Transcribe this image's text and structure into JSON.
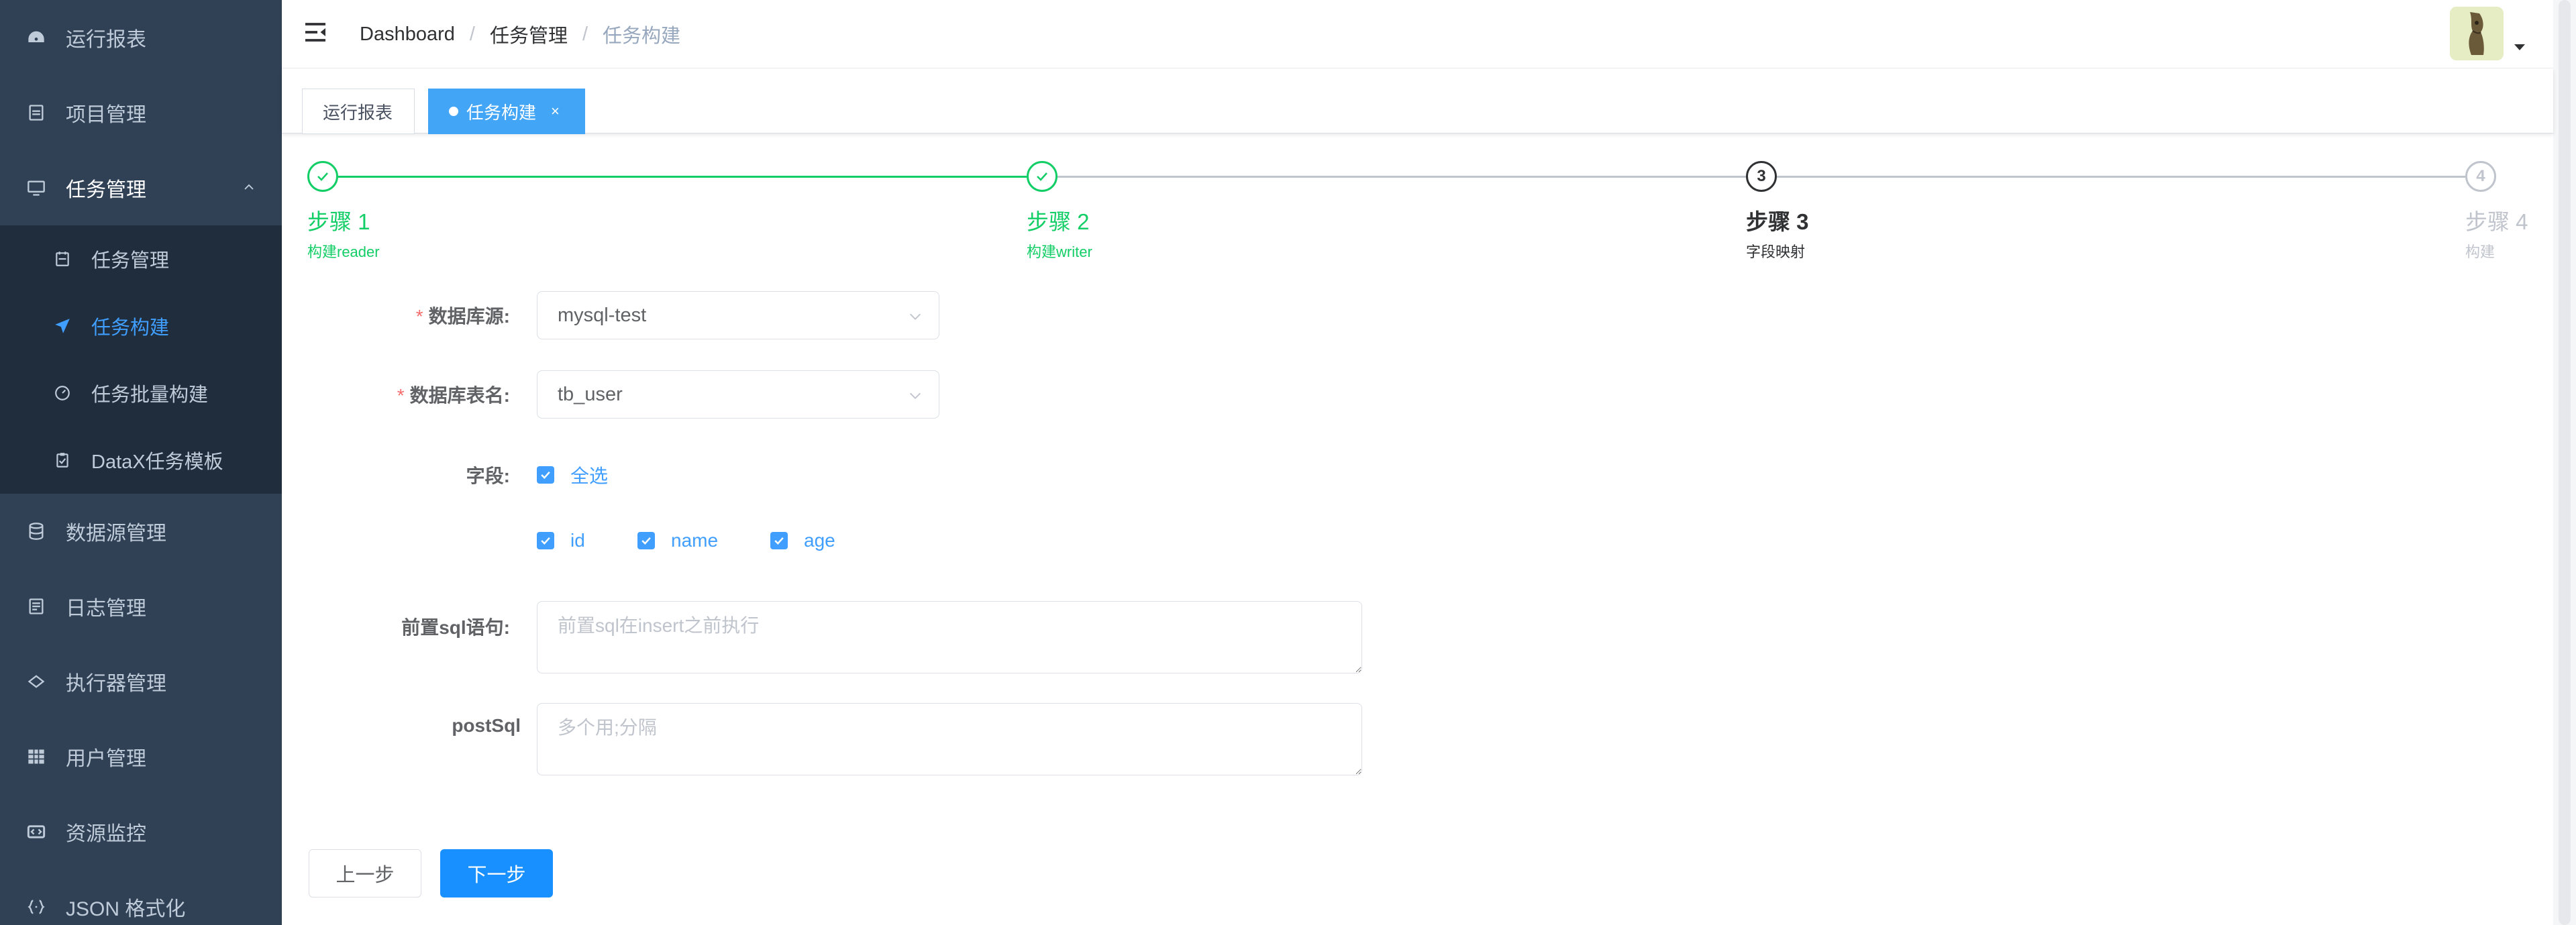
{
  "sidebar": {
    "items": [
      {
        "label": "运行报表",
        "icon": "dashboard-icon"
      },
      {
        "label": "项目管理",
        "icon": "project-icon"
      },
      {
        "label": "任务管理",
        "icon": "monitor-icon",
        "expanded": true
      },
      {
        "label": "数据源管理",
        "icon": "database-icon"
      },
      {
        "label": "日志管理",
        "icon": "log-icon"
      },
      {
        "label": "执行器管理",
        "icon": "executor-icon"
      },
      {
        "label": "用户管理",
        "icon": "table-icon"
      },
      {
        "label": "资源监控",
        "icon": "monitor-code-icon"
      },
      {
        "label": "JSON 格式化",
        "icon": "json-icon"
      }
    ],
    "submenu": [
      {
        "label": "任务管理",
        "icon": "calendar-icon"
      },
      {
        "label": "任务构建",
        "icon": "send-icon",
        "active": true
      },
      {
        "label": "任务批量构建",
        "icon": "dashboard-gauge-icon"
      },
      {
        "label": "DataX任务模板",
        "icon": "clipboard-icon"
      }
    ],
    "colors": {
      "background": "#304156",
      "submenu_background": "#1f2d3d",
      "active": "#409eff"
    }
  },
  "navbar": {
    "breadcrumb": [
      "Dashboard",
      "任务管理",
      "任务构建"
    ],
    "separator": "/"
  },
  "tags": {
    "items": [
      {
        "label": "运行报表",
        "active": false
      },
      {
        "label": "任务构建",
        "active": true,
        "close": "×"
      }
    ]
  },
  "steps": {
    "items": [
      {
        "number": "1",
        "title": "步骤 1",
        "desc": "构建reader",
        "status": "success"
      },
      {
        "number": "2",
        "title": "步骤 2",
        "desc": "构建writer",
        "status": "success"
      },
      {
        "number": "3",
        "title": "步骤 3",
        "desc": "字段映射",
        "status": "process"
      },
      {
        "number": "4",
        "title": "步骤 4",
        "desc": "构建",
        "status": "wait"
      }
    ],
    "colors": {
      "success": "#13ce66",
      "process": "#303133",
      "wait": "#c0c4cc"
    }
  },
  "form": {
    "datasource": {
      "label": "数据库源:",
      "value": "mysql-test",
      "required": "*"
    },
    "table": {
      "label": "数据库表名:",
      "value": "tb_user",
      "required": "*"
    },
    "fields": {
      "label": "字段:",
      "select_all": "全选",
      "options": [
        "id",
        "name",
        "age"
      ]
    },
    "pre_sql": {
      "label": "前置sql语句:",
      "placeholder": "前置sql在insert之前执行"
    },
    "post_sql": {
      "label": "postSql",
      "placeholder": "多个用;分隔"
    }
  },
  "buttons": {
    "prev": "上一步",
    "next": "下一步"
  }
}
